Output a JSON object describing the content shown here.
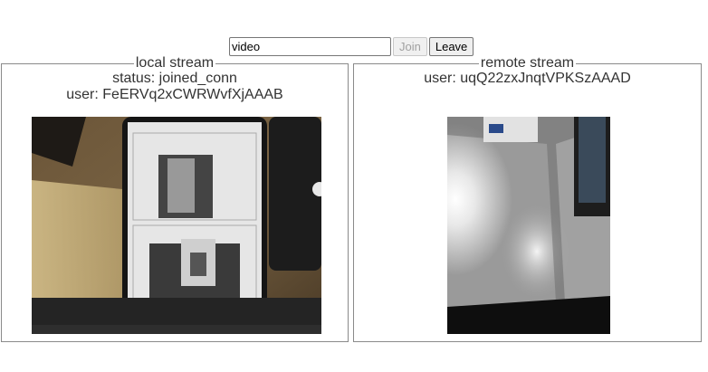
{
  "controls": {
    "room_value": "video",
    "join_label": "Join",
    "leave_label": "Leave"
  },
  "local": {
    "legend": "local stream",
    "status": "status: joined_conn",
    "user": "user: FeERVq2xCWRWvfXjAAAB"
  },
  "remote": {
    "legend": "remote stream",
    "user": "user: uqQ22zxJnqtVPKSzAAAD"
  }
}
